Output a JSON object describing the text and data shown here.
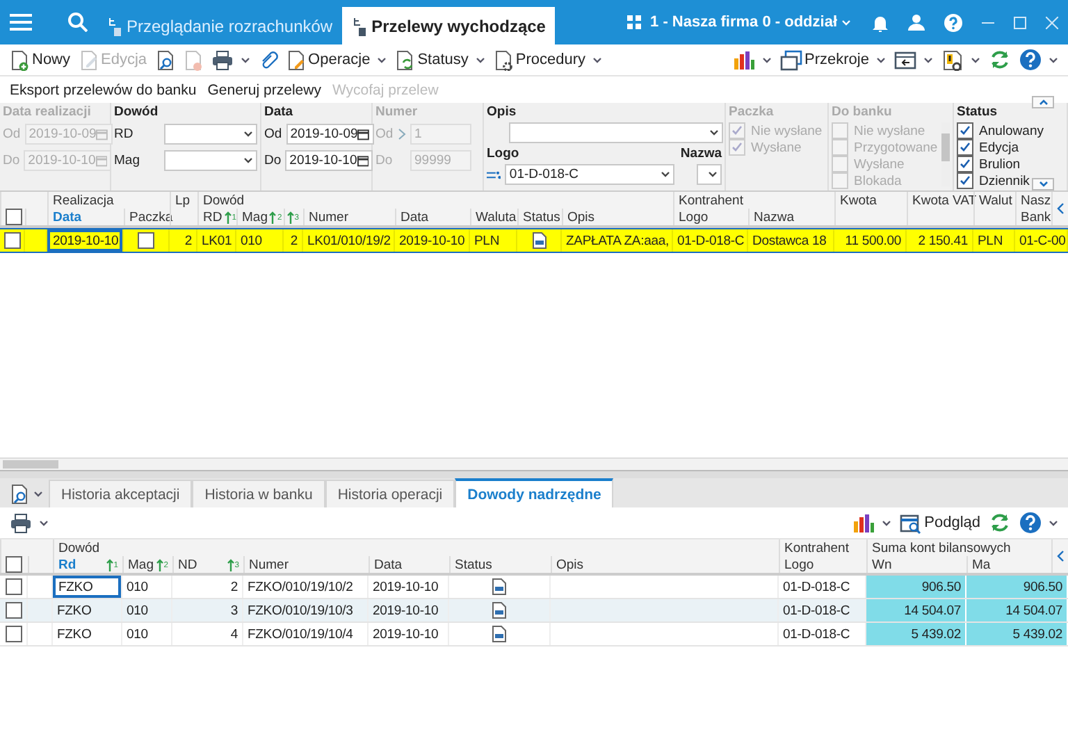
{
  "title_bar": {
    "tabs": [
      {
        "label": "Przeglądanie rozrachunków",
        "selected": false
      },
      {
        "label": "Przelewy wychodzące",
        "selected": true
      }
    ],
    "company": "1 - Nasza firma 0 - oddział"
  },
  "toolbar": {
    "left": [
      {
        "label": "Nowy",
        "disabled": false,
        "dropdown": false
      },
      {
        "label": "Edycja",
        "disabled": true,
        "dropdown": false
      },
      {
        "disabled": false,
        "dropdown": false
      },
      {
        "disabled": true,
        "dropdown": false
      },
      {
        "disabled": false,
        "dropdown": true
      },
      {
        "disabled": false,
        "dropdown": false
      },
      {
        "label": "Operacje",
        "disabled": false,
        "dropdown": true
      },
      {
        "label": "Statusy",
        "disabled": false,
        "dropdown": true
      },
      {
        "label": "Procedury",
        "disabled": false,
        "dropdown": true
      }
    ],
    "right": [
      {
        "disabled": false,
        "dropdown": true
      },
      {
        "label": "Przekroje",
        "disabled": false,
        "dropdown": true
      },
      {
        "disabled": false,
        "dropdown": true
      },
      {
        "disabled": false,
        "dropdown": true
      },
      {
        "disabled": false,
        "dropdown": false
      },
      {
        "disabled": false,
        "dropdown": true
      }
    ]
  },
  "actions": [
    {
      "label": "Eksport przelewów do banku",
      "disabled": false
    },
    {
      "label": "Generuj przelewy",
      "disabled": false
    },
    {
      "label": "Wycofaj przelew",
      "disabled": true
    }
  ],
  "filters": {
    "realization_date": {
      "title": "Data realizacji",
      "disabled": true,
      "rows": [
        {
          "label": "Od",
          "value": "2019-10-09"
        },
        {
          "label": "Do",
          "value": "2019-10-10"
        }
      ]
    },
    "document": {
      "title": "Dowód",
      "rows": [
        {
          "label": "RD"
        },
        {
          "label": "Mag"
        }
      ]
    },
    "date": {
      "title": "Data",
      "disabled": false,
      "rows": [
        {
          "label": "Od",
          "value": "2019-10-09"
        },
        {
          "label": "Do",
          "value": "2019-10-10"
        }
      ]
    },
    "number": {
      "title": "Numer",
      "disabled": true,
      "rows": [
        {
          "label": "Od",
          "value": "1"
        },
        {
          "label": "Do",
          "value": "99999"
        }
      ]
    },
    "description": {
      "title": "Opis"
    },
    "logo": {
      "title": "Logo",
      "value": "01-D-018-C"
    },
    "name": {
      "title": "Nazwa"
    },
    "package": {
      "title": "Paczka",
      "disabled": true,
      "options": [
        {
          "label": "Nie wysłane",
          "checked": true
        },
        {
          "label": "Wysłane",
          "checked": true
        }
      ]
    },
    "to_bank": {
      "title": "Do banku",
      "disabled": true,
      "options": [
        {
          "label": "Nie wysłane",
          "checked": false
        },
        {
          "label": "Przygotowane",
          "checked": false
        },
        {
          "label": "Wysłane",
          "checked": false
        },
        {
          "label": "Blokada",
          "checked": false
        }
      ]
    },
    "status": {
      "title": "Status",
      "disabled": false,
      "options": [
        {
          "label": "Anulowany",
          "checked": true
        },
        {
          "label": "Edycja",
          "checked": true
        },
        {
          "label": "Brulion",
          "checked": true
        },
        {
          "label": "Dziennik",
          "checked": true
        }
      ]
    }
  },
  "top_grid": {
    "all_checked": false,
    "columns": [
      {
        "kind": "check"
      },
      {
        "kind": "blank"
      },
      {
        "kind": "text",
        "top": "Realizacja",
        "bottom": "Data",
        "sorted": true
      },
      {
        "kind": "check",
        "bottom": "Paczka",
        "sorted": false
      },
      {
        "kind": "num",
        "top": "Lp"
      },
      {
        "kind": "text",
        "top": "Dowód",
        "bottom": "RD",
        "sort": "1",
        "sorted": false
      },
      {
        "kind": "text",
        "bottom": "Mag",
        "sort": "2",
        "sorted": false
      },
      {
        "kind": "num",
        "sort": "3"
      },
      {
        "kind": "text",
        "bottom": "Numer",
        "sorted": false
      },
      {
        "kind": "text",
        "bottom": "Data",
        "sorted": false
      },
      {
        "kind": "text",
        "bottom": "Waluta",
        "sorted": false
      },
      {
        "kind": "icon",
        "bottom": "Status",
        "sorted": false
      },
      {
        "kind": "text",
        "bottom": "Opis",
        "sorted": false
      },
      {
        "kind": "text",
        "top": "Kontrahent",
        "bottom": "Logo",
        "sorted": false
      },
      {
        "kind": "text",
        "bottom": "Nazwa",
        "sorted": false
      },
      {
        "kind": "num",
        "top": "Kwota"
      },
      {
        "kind": "num",
        "top": "Kwota VAT"
      },
      {
        "kind": "text",
        "top": "Walut"
      },
      {
        "kind": "text",
        "top": "Nasz",
        "bottom": "Bank",
        "sorted": false
      }
    ],
    "rows": [
      {
        "selected": true,
        "cells": [
          false,
          "",
          {
            "text": "2019-10-10",
            "focused": true
          },
          false,
          "2",
          "LK01",
          "010",
          "2",
          "LK01/010/19/2",
          "2019-10-10",
          "PLN",
          "",
          "ZAPŁATA ZA:aaa,",
          "01-D-018-C",
          "Dostawca 18",
          "11 500.00",
          "2 150.41",
          "PLN",
          "01-C-00"
        ]
      }
    ]
  },
  "bottom_tabs": [
    {
      "label": "Historia akceptacji",
      "selected": false
    },
    {
      "label": "Historia w banku",
      "selected": false
    },
    {
      "label": "Historia operacji",
      "selected": false
    },
    {
      "label": "Dowody nadrzędne",
      "selected": true
    }
  ],
  "bottom_toolbar": {
    "left": [
      {
        "disabled": false,
        "dropdown": true
      }
    ],
    "right": [
      {
        "disabled": false,
        "dropdown": true
      },
      {
        "label": "Podgląd",
        "disabled": false,
        "dropdown": false
      },
      {
        "disabled": false,
        "dropdown": false
      },
      {
        "disabled": false,
        "dropdown": true
      }
    ]
  },
  "bottom_grid": {
    "all_checked": false,
    "columns": [
      {
        "kind": "check"
      },
      {
        "kind": "blank"
      },
      {
        "kind": "text",
        "top": "Dowód",
        "bottom": "Rd",
        "sort": "1",
        "sorted": true,
        "highlighted": false
      },
      {
        "kind": "text",
        "bottom": "Mag",
        "sort": "2",
        "sorted": false,
        "highlighted": false
      },
      {
        "kind": "num",
        "bottom": "ND",
        "sort": "3",
        "sorted": false,
        "highlighted": false
      },
      {
        "kind": "text",
        "bottom": "Numer",
        "sorted": false,
        "highlighted": false
      },
      {
        "kind": "text",
        "bottom": "Data",
        "sorted": false,
        "highlighted": false
      },
      {
        "kind": "icon",
        "bottom": "Status",
        "sorted": false,
        "highlighted": false
      },
      {
        "kind": "text",
        "bottom": "Opis",
        "sorted": false,
        "highlighted": false
      },
      {
        "kind": "text",
        "top": "Kontrahent",
        "bottom": "Logo",
        "sorted": false,
        "highlighted": false
      },
      {
        "kind": "num",
        "top": "Suma kont bilansowych",
        "bottom": "Wn",
        "sorted": false,
        "highlighted": true
      },
      {
        "kind": "num",
        "bottom": "Ma",
        "sorted": false,
        "highlighted": true
      }
    ],
    "rows": [
      {
        "selected": false,
        "cells": [
          false,
          "",
          {
            "text": "FZKO",
            "focused": true
          },
          "010",
          "2",
          "FZKO/010/19/10/2",
          "2019-10-10",
          "",
          "",
          "01-D-018-C",
          "906.50",
          "906.50"
        ]
      },
      {
        "selected": false,
        "cells": [
          false,
          "",
          "FZKO",
          "010",
          "3",
          "FZKO/010/19/10/3",
          "2019-10-10",
          "",
          "",
          "01-D-018-C",
          "14 504.07",
          "14 504.07"
        ]
      },
      {
        "selected": false,
        "cells": [
          false,
          "",
          "FZKO",
          "010",
          "4",
          "FZKO/010/19/10/4",
          "2019-10-10",
          "",
          "",
          "01-D-018-C",
          "5 439.02",
          "5 439.02"
        ]
      }
    ]
  }
}
